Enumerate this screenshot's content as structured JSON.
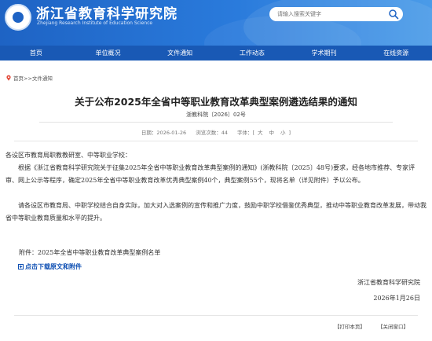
{
  "header": {
    "title": "浙江省教育科学研究院",
    "subtitle": "Zhejiang Research Institute of Education Science",
    "search_placeholder": "请输入搜索关键字"
  },
  "nav": {
    "items": [
      {
        "label": "首页"
      },
      {
        "label": "单位概况"
      },
      {
        "label": "文件通知"
      },
      {
        "label": "工作动态"
      },
      {
        "label": "学术期刊"
      },
      {
        "label": "在线资源"
      }
    ]
  },
  "breadcrumb": {
    "text": "首页>>文件通知"
  },
  "article": {
    "title": "关于公布2025年全省中等职业教育改革典型案例遴选结果的通知",
    "doc_number": "浙教科院〔2026〕02号",
    "date_label": "日期：2026-01-26",
    "views_label": "浏览次数：44",
    "font_size_label": "字体：",
    "font_sizes": [
      "大",
      "中",
      "小"
    ],
    "salutation": "各设区市教育局职教教研室、中等职业学校：",
    "paragraph1": "根据《浙江省教育科学研究院关于征集2025年全省中等职业教育改革典型案例的通知》(浙教科院〔2025〕48号)要求，经各地市推荐、专家评审、网上公示等程序，确定2025年全省中等职业教育改革优秀典型案例40个，典型案例55个，现将名单（详见附件）予以公布。",
    "paragraph2": "请各设区市教育局、中职学校结合自身实际，加大对入选案例的宣传和推广力度，鼓励中职学校借鉴优秀典型，推动中等职业教育改革发展，带动我省中等职业教育质量和水平的提升。",
    "attachment": "附件：2025年全省中等职业教育改革典型案例名单",
    "download_label": "点击下载原文和附件",
    "signature": "浙江省教育科学研究院",
    "signature_date": "2026年1月26日"
  },
  "footer": {
    "print_label": "【打印本页】",
    "close_label": "【关闭窗口】"
  },
  "colors": {
    "header_blue": "#1e63c4",
    "nav_blue": "#1959b5",
    "link_blue": "#0e4fb3"
  }
}
